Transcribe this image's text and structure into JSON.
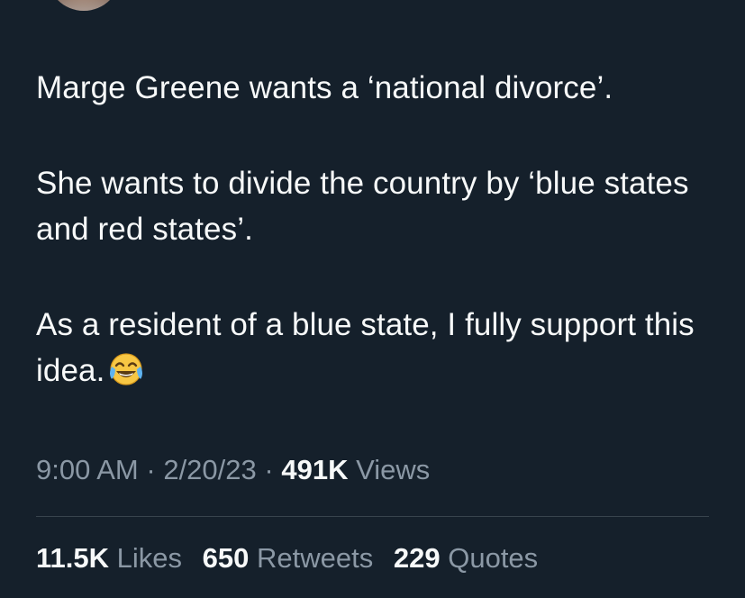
{
  "tweet": {
    "paragraphs": [
      "Marge Greene wants a ‘national divorce’.",
      "She wants to divide the country by ‘blue states and red states’.",
      "As a resident of a blue state, I fully support this idea."
    ],
    "emoji": "face-with-tears-of-joy-icon"
  },
  "meta": {
    "time": "9:00 AM",
    "separator": "·",
    "date": "2/20/23",
    "views_count": "491K",
    "views_label": "Views"
  },
  "stats": {
    "likes_count": "11.5K",
    "likes_label": "Likes",
    "retweets_count": "650",
    "retweets_label": "Retweets",
    "quotes_count": "229",
    "quotes_label": "Quotes"
  },
  "colors": {
    "background": "#15202b",
    "text": "#f7f9f9",
    "secondary": "#8b98a5",
    "divider": "#38444d"
  }
}
